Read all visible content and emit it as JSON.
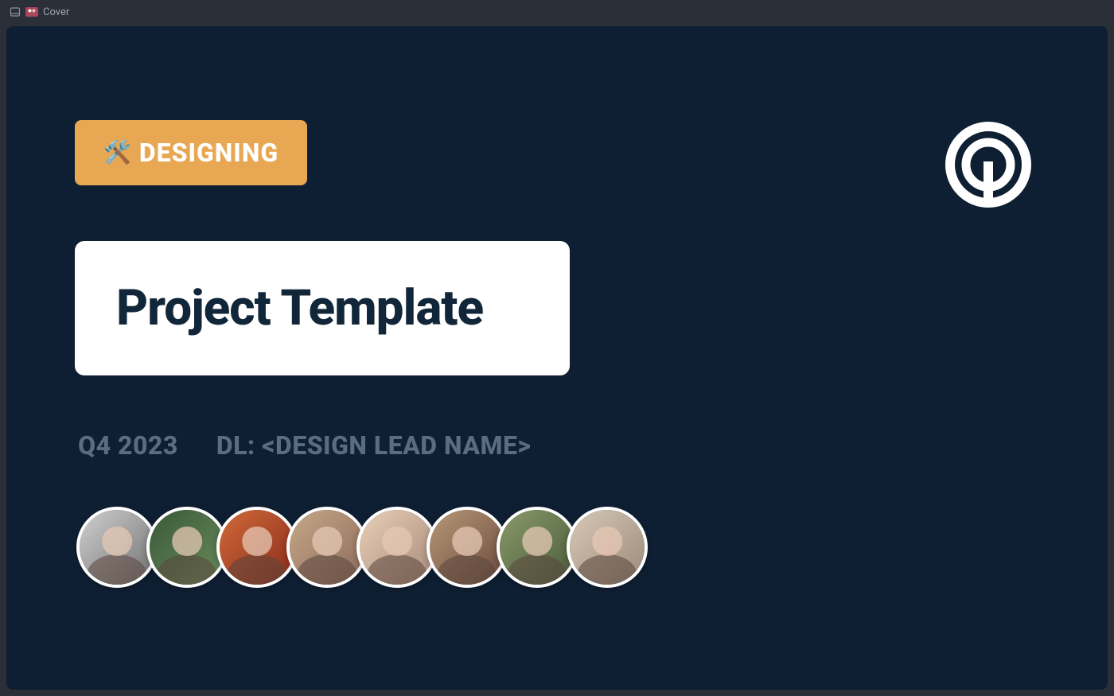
{
  "toolbar": {
    "page_label": "Cover"
  },
  "slide": {
    "status": {
      "emoji": "🛠️",
      "label": "DESIGNING"
    },
    "title": "Project Template",
    "meta": {
      "period": "Q4 2023",
      "lead_label": "DL: <DESIGN LEAD NAME>"
    },
    "avatar_count": 8
  },
  "colors": {
    "slide_bg": "#0f1f33",
    "status_bg": "#e8a752",
    "title_card_bg": "#ffffff",
    "title_text": "#12263a",
    "meta_text": "#5a6d80",
    "app_bg": "#2a2f38"
  }
}
